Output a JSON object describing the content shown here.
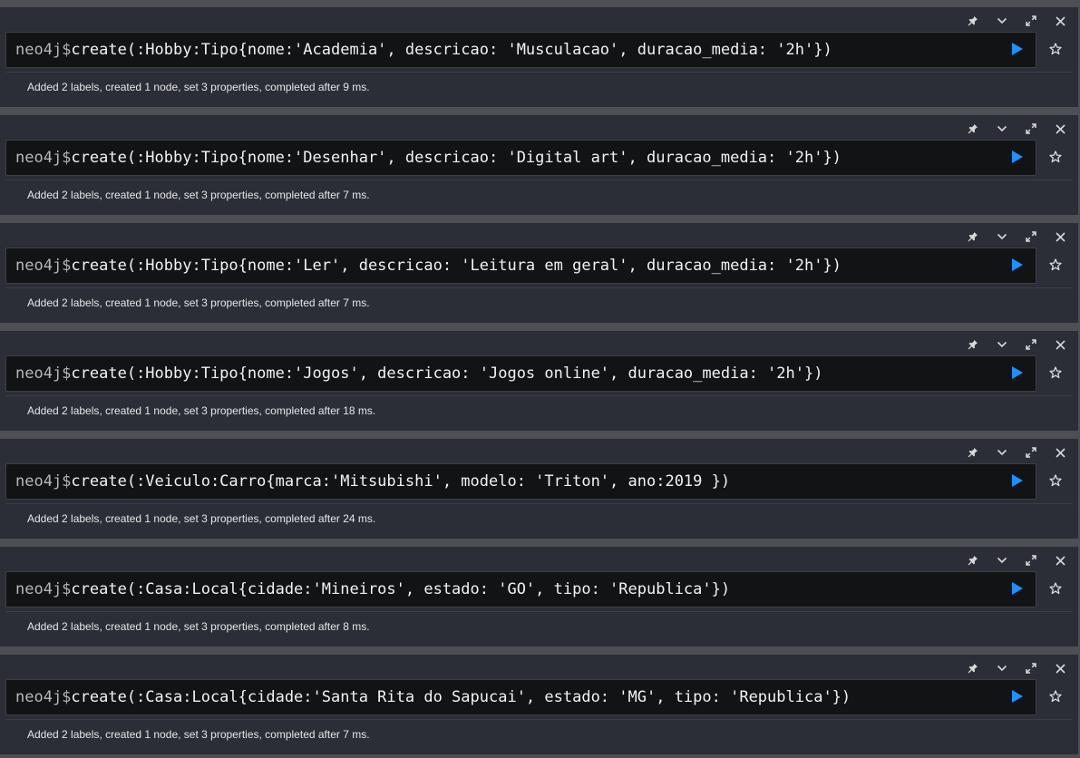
{
  "icons": {
    "pin": "pin-icon",
    "collapse": "chevron-down-icon",
    "fullscreen": "expand-icon",
    "close": "close-icon",
    "run": "play-icon",
    "favorite": "star-icon"
  },
  "colors": {
    "run_accent": "#1e90ff",
    "frame_bg": "#2b2e37",
    "editor_bg": "#121314",
    "page_bg": "#4d4f55"
  },
  "frames": [
    {
      "prompt": "neo4j$",
      "command": "create(:Hobby:Tipo{nome:'Academia', descricao: 'Musculacao', duracao_media: '2h'})",
      "result": "Added 2 labels, created 1 node, set 3 properties, completed after 9 ms."
    },
    {
      "prompt": "neo4j$",
      "command": "create(:Hobby:Tipo{nome:'Desenhar', descricao: 'Digital art', duracao_media: '2h'})",
      "result": "Added 2 labels, created 1 node, set 3 properties, completed after 7 ms."
    },
    {
      "prompt": "neo4j$",
      "command": "create(:Hobby:Tipo{nome:'Ler', descricao: 'Leitura em geral', duracao_media: '2h'})",
      "result": "Added 2 labels, created 1 node, set 3 properties, completed after 7 ms."
    },
    {
      "prompt": "neo4j$",
      "command": "create(:Hobby:Tipo{nome:'Jogos', descricao: 'Jogos online', duracao_media: '2h'})",
      "result": "Added 2 labels, created 1 node, set 3 properties, completed after 18 ms."
    },
    {
      "prompt": "neo4j$",
      "command": "create(:Veiculo:Carro{marca:'Mitsubishi', modelo: 'Triton', ano:2019 })",
      "result": "Added 2 labels, created 1 node, set 3 properties, completed after 24 ms."
    },
    {
      "prompt": "neo4j$",
      "command": "create(:Casa:Local{cidade:'Mineiros', estado: 'GO', tipo: 'Republica'})",
      "result": "Added 2 labels, created 1 node, set 3 properties, completed after 8 ms."
    },
    {
      "prompt": "neo4j$",
      "command": "create(:Casa:Local{cidade:'Santa Rita do Sapucai', estado: 'MG', tipo: 'Republica'})",
      "result": "Added 2 labels, created 1 node, set 3 properties, completed after 7 ms."
    }
  ]
}
